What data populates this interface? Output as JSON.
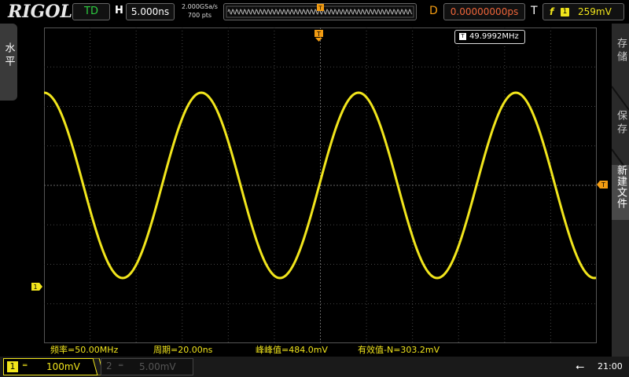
{
  "header": {
    "brand": "RIGOL",
    "run_status": "TD",
    "horizontal_label": "H",
    "timebase": "5.000ns",
    "sample_rate": "2.000GSa/s",
    "memory_depth": "700 pts",
    "delay_label": "D",
    "delay_value": "0.00000000ps",
    "trigger_label": "T",
    "trigger_slope": "f",
    "trigger_channel": "1",
    "trigger_level": "259mV"
  },
  "left_menu": {
    "label": "水平"
  },
  "right_menu": {
    "items": [
      "存储",
      "保存",
      "新建文件"
    ]
  },
  "screen": {
    "frequency_counter": "49.9992MHz",
    "channel1_marker": "1",
    "trigger_marker": "T"
  },
  "measurements": [
    "频率=50.00MHz",
    "周期=20.00ns",
    "峰峰值=484.0mV",
    "有效值-N=303.2mV"
  ],
  "footer": {
    "ch1_number": "1",
    "ch1_scale": "100mV",
    "ch2_number": "2",
    "ch2_scale": "5.00mV",
    "clock": "21:00"
  },
  "colors": {
    "ch1": "#f1e51c",
    "trigger": "#f39c12",
    "delay": "#f0663a",
    "run": "#2ecc40"
  }
}
